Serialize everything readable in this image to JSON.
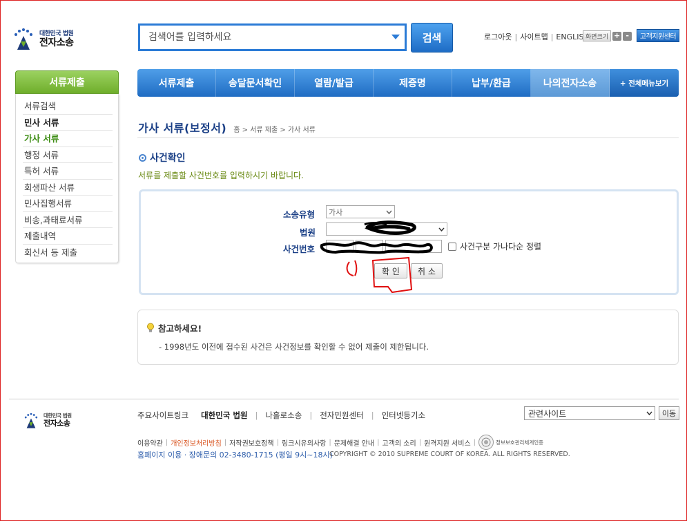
{
  "header": {
    "logo_sub": "대한민국 법원",
    "logo_main": "전자소송",
    "search_placeholder": "검색어를 입력하세요",
    "search_button": "검색",
    "util_links": [
      "로그아웃",
      "사이트맵",
      "ENGLISH"
    ],
    "fontsize_label": "화면크기",
    "fontsize_plus": "+",
    "fontsize_minus": "-",
    "customer_center": "고객지원센터"
  },
  "sidebar": {
    "title": "서류제출",
    "items": [
      {
        "label": "서류검색",
        "style": "normal"
      },
      {
        "label": "민사 서류",
        "style": "bold"
      },
      {
        "label": "가사 서류",
        "style": "active"
      },
      {
        "label": "행정 서류",
        "style": "normal"
      },
      {
        "label": "특허 서류",
        "style": "normal"
      },
      {
        "label": "회생파산 서류",
        "style": "normal"
      },
      {
        "label": "민사집행서류",
        "style": "normal"
      },
      {
        "label": "비송,과태료서류",
        "style": "normal"
      },
      {
        "label": "제출내역",
        "style": "normal"
      },
      {
        "label": "회신서 등 제출",
        "style": "normal"
      }
    ]
  },
  "nav": {
    "items": [
      "서류제출",
      "송달문서확인",
      "열람/발급",
      "제증명",
      "납부/환급",
      "나의전자소송"
    ],
    "selected_index": 5,
    "all_menu": "+ 전체메뉴보기"
  },
  "page": {
    "title": "가사 서류(보정서)",
    "breadcrumb": "홈 > 서류 제출 > 가사 서류",
    "section_title": "사건확인",
    "instruction": "서류를 제출할 사건번호를 입력하시기 바랍니다."
  },
  "form": {
    "type_label": "소송유형",
    "type_value": "가사",
    "court_label": "법원",
    "court_value": "",
    "case_label": "사건번호",
    "sort_checkbox_label": "사건구분 가나다순 정렬",
    "confirm_button": "확 인",
    "cancel_button": "취 소"
  },
  "notice": {
    "title": "참고하세요!",
    "text": "- 1998년도 이전에 접수된 사건은 사건정보를 확인할 수 없어 제출이 제한됩니다."
  },
  "footer": {
    "logo_sub": "대한민국 법원",
    "logo_main": "전자소송",
    "links_label": "주요사이트링크",
    "links": [
      "대한민국 법원",
      "나홀로소송",
      "전자민원센터",
      "인터넷등기소"
    ],
    "related_site": "관련사이트",
    "go_button": "이동",
    "policy": [
      "이용약관",
      "개인정보처리방침",
      "저작권보호정책",
      "링크시유의사항",
      "문제해결 안내",
      "고객의 소리",
      "원격지원 서비스"
    ],
    "seal_text": "정보보호관리체계인증",
    "contact": "홈페이지 이용 · 장애문의 02-3480-1715 (평일 9시~18시)",
    "copyright": "COPYRIGHT © 2010 SUPREME COURT OF KOREA. ALL RIGHTS RESERVED."
  },
  "colors": {
    "brand_blue": "#1f6cc3",
    "sidebar_green": "#6fae2b",
    "active_green": "#3c8c12",
    "title_navy": "#1a3f86",
    "annotation_red": "#e01010"
  }
}
